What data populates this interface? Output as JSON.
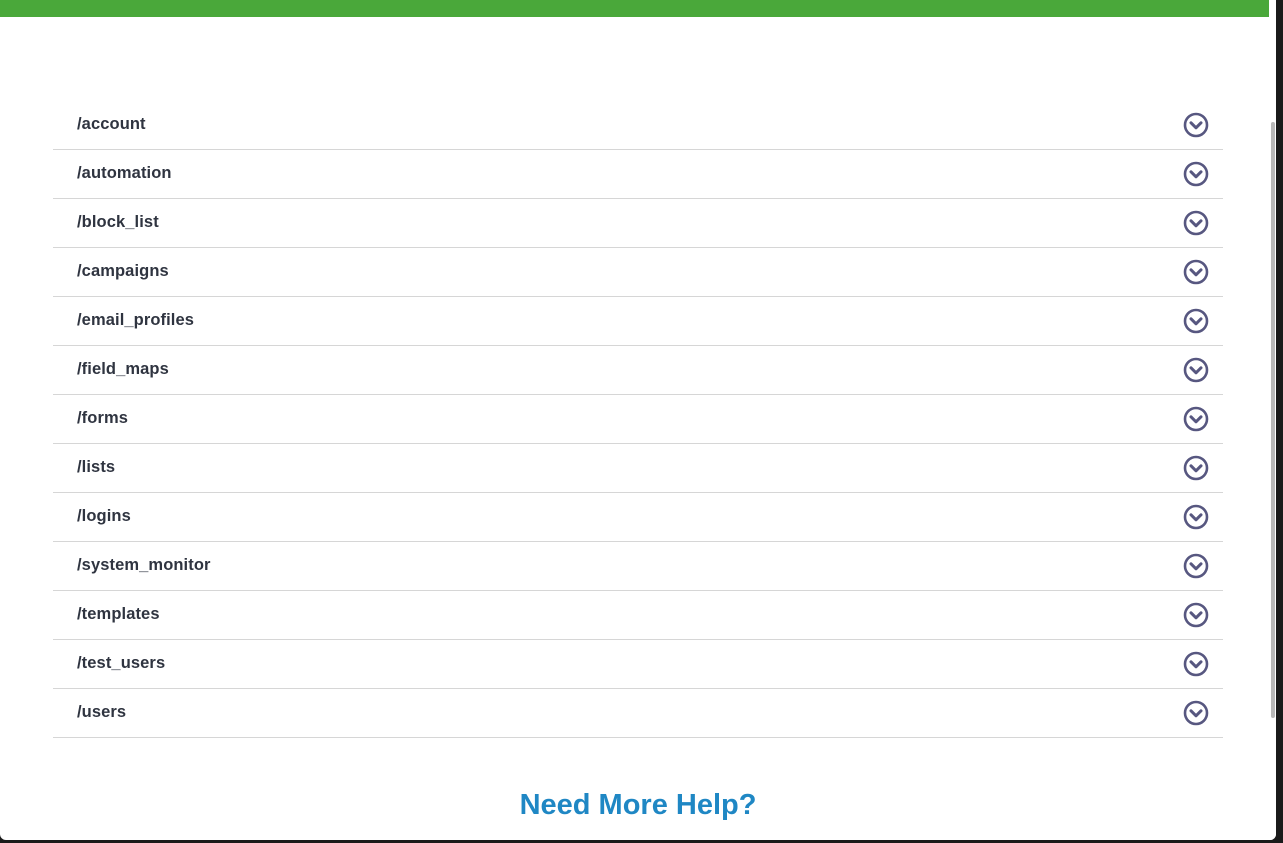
{
  "colors": {
    "header_bar": "#4aa83a",
    "text": "#2f3440",
    "divider": "#d6d6d6",
    "chevron": "#575780",
    "help_heading": "#1f87c4"
  },
  "endpoints": [
    {
      "label": "/account",
      "icon": "chevron-down-circle-icon"
    },
    {
      "label": "/automation",
      "icon": "chevron-down-circle-icon"
    },
    {
      "label": "/block_list",
      "icon": "chevron-down-circle-icon"
    },
    {
      "label": "/campaigns",
      "icon": "chevron-down-circle-icon"
    },
    {
      "label": "/email_profiles",
      "icon": "chevron-down-circle-icon"
    },
    {
      "label": "/field_maps",
      "icon": "chevron-down-circle-icon"
    },
    {
      "label": "/forms",
      "icon": "chevron-down-circle-icon"
    },
    {
      "label": "/lists",
      "icon": "chevron-down-circle-icon"
    },
    {
      "label": "/logins",
      "icon": "chevron-down-circle-icon"
    },
    {
      "label": "/system_monitor",
      "icon": "chevron-down-circle-icon"
    },
    {
      "label": "/templates",
      "icon": "chevron-down-circle-icon"
    },
    {
      "label": "/test_users",
      "icon": "chevron-down-circle-icon"
    },
    {
      "label": "/users",
      "icon": "chevron-down-circle-icon"
    }
  ],
  "help": {
    "heading": "Need More Help?"
  }
}
